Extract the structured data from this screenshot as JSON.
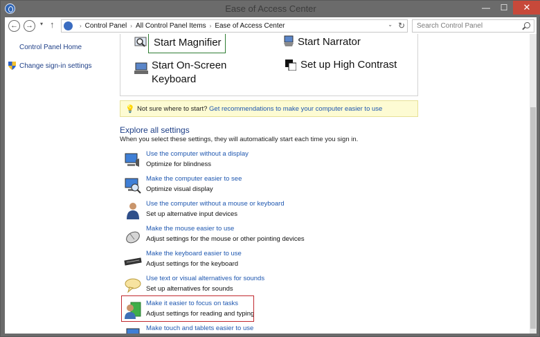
{
  "window": {
    "title": "Ease of Access Center",
    "minimize_label": "—",
    "maximize_label": "☐",
    "close_label": "✕"
  },
  "nav": {
    "back_label": "←",
    "forward_label": "→",
    "recent_label": "▾",
    "up_label": "↑",
    "breadcrumbs": [
      "Control Panel",
      "All Control Panel Items",
      "Ease of Access Center"
    ],
    "breadcrumb_separator": "›",
    "dropdown_label": "⌄",
    "refresh_label": "↻",
    "search_placeholder": "Search Control Panel"
  },
  "sidebar": {
    "items": [
      {
        "label": "Control Panel Home"
      },
      {
        "label": "Change sign-in settings",
        "icon": "shield-icon"
      }
    ]
  },
  "quick_access": {
    "magnifier": "Start Magnifier",
    "narrator": "Start Narrator",
    "osk_line1": "Start On-Screen",
    "osk_line2": "Keyboard",
    "contrast": "Set up High Contrast"
  },
  "tip": {
    "prefix": "Not sure where to start?",
    "link": "Get recommendations to make your computer easier to use"
  },
  "explore": {
    "title": "Explore all settings",
    "description": "When you select these settings, they will automatically start each time you sign in.",
    "settings": [
      {
        "link": "Use the computer without a display",
        "desc": "Optimize for blindness",
        "icon": "monitor-speaker-icon"
      },
      {
        "link": "Make the computer easier to see",
        "desc": "Optimize visual display",
        "icon": "monitor-magnifier-icon"
      },
      {
        "link": "Use the computer without a mouse or keyboard",
        "desc": "Set up alternative input devices",
        "icon": "person-icon"
      },
      {
        "link": "Make the mouse easier to use",
        "desc": "Adjust settings for the mouse or other pointing devices",
        "icon": "mouse-icon"
      },
      {
        "link": "Make the keyboard easier to use",
        "desc": "Adjust settings for the keyboard",
        "icon": "keyboard-icon"
      },
      {
        "link": "Use text or visual alternatives for sounds",
        "desc": "Set up alternatives for sounds",
        "icon": "speech-bubble-icon"
      },
      {
        "link": "Make it easier to focus on tasks",
        "desc": "Adjust settings for reading and typing",
        "icon": "focus-user-icon"
      },
      {
        "link": "Make touch and tablets easier to use",
        "desc": "",
        "icon": "tablet-icon"
      }
    ]
  },
  "colors": {
    "link": "#1e57b0",
    "highlight_red": "#c0272d",
    "highlight_green": "#2e7d32",
    "tip_bg": "#fdfbd3"
  }
}
